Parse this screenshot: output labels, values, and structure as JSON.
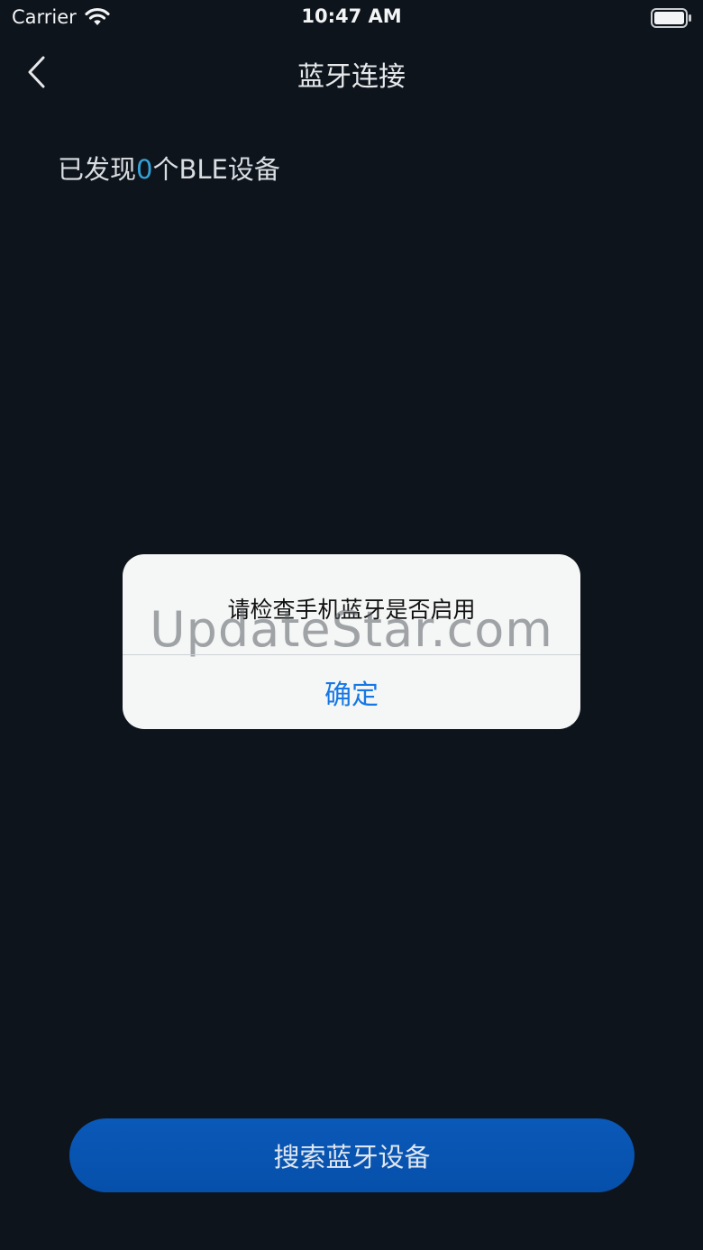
{
  "status_bar": {
    "carrier": "Carrier",
    "time": "10:47 AM",
    "wifi_icon": "wifi-icon",
    "battery_icon": "battery-icon"
  },
  "nav": {
    "back_icon": "chevron-left-icon",
    "title": "蓝牙连接"
  },
  "found": {
    "prefix": "已发现",
    "count": "0",
    "suffix": "个BLE设备",
    "count_color": "#35a3d8"
  },
  "alert": {
    "message": "请检查手机蓝牙是否启用",
    "confirm_label": "确定",
    "confirm_color": "#1677e5"
  },
  "watermark": {
    "text": "UpdateStar.com"
  },
  "bottom": {
    "search_label": "搜索蓝牙设备",
    "button_color": "#0a58b8"
  }
}
